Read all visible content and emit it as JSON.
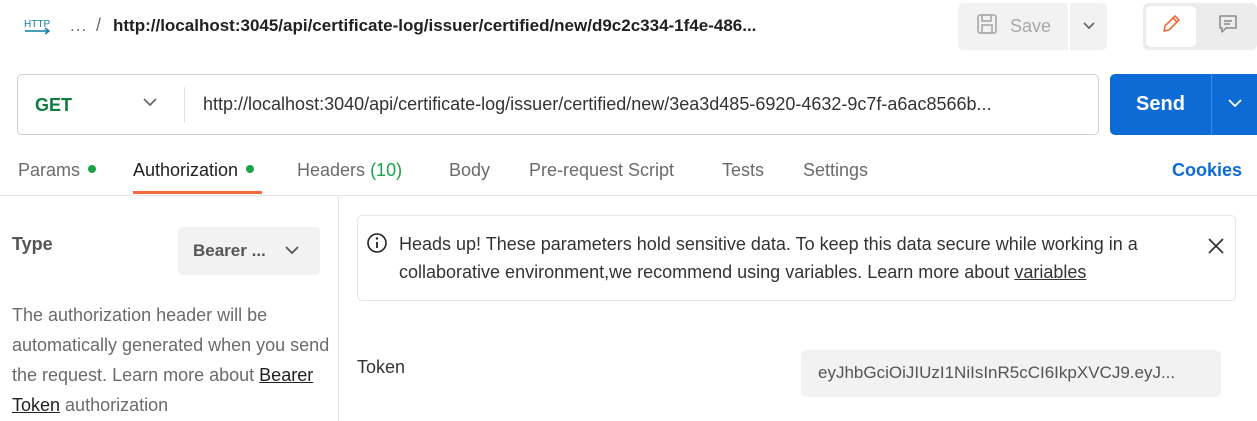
{
  "header": {
    "icon_text": "HTTP",
    "breadcrumb_dots": "...",
    "breadcrumb_sep": "/",
    "title": "http://localhost:3045/api/certificate-log/issuer/certified/new/d9c2c334-1f4e-486...",
    "save_label": "Save"
  },
  "request": {
    "method": "GET",
    "url": "http://localhost:3040/api/certificate-log/issuer/certified/new/3ea3d485-6920-4632-9c7f-a6ac8566b...",
    "send_label": "Send"
  },
  "tabs": [
    {
      "label": "Params"
    },
    {
      "label": "Authorization"
    },
    {
      "label": "Headers",
      "count": "(10)"
    },
    {
      "label": "Body"
    },
    {
      "label": "Pre-request Script"
    },
    {
      "label": "Tests"
    },
    {
      "label": "Settings"
    }
  ],
  "cookies_label": "Cookies",
  "auth": {
    "type_label": "Type",
    "type_value": "Bearer ...",
    "desc_1": "The authorization header will be automatically generated when you send the request. Learn more about ",
    "desc_link": "Bearer Token",
    "desc_2": " authorization"
  },
  "notice": {
    "text": "Heads up! These parameters hold sensitive data. To keep this data secure while working in a collaborative environment,we recommend using variables. Learn more about ",
    "link": "variables"
  },
  "token": {
    "label": "Token",
    "value": "eyJhbGciOiJIUzI1NiIsInR5cCI6IkpXVCJ9.eyJ..."
  },
  "colors": {
    "accent": "#0d6bd6",
    "method_get": "#0f7b3e",
    "active_tab_underline": "#f26b3a",
    "status_dot": "#1aa34a"
  }
}
